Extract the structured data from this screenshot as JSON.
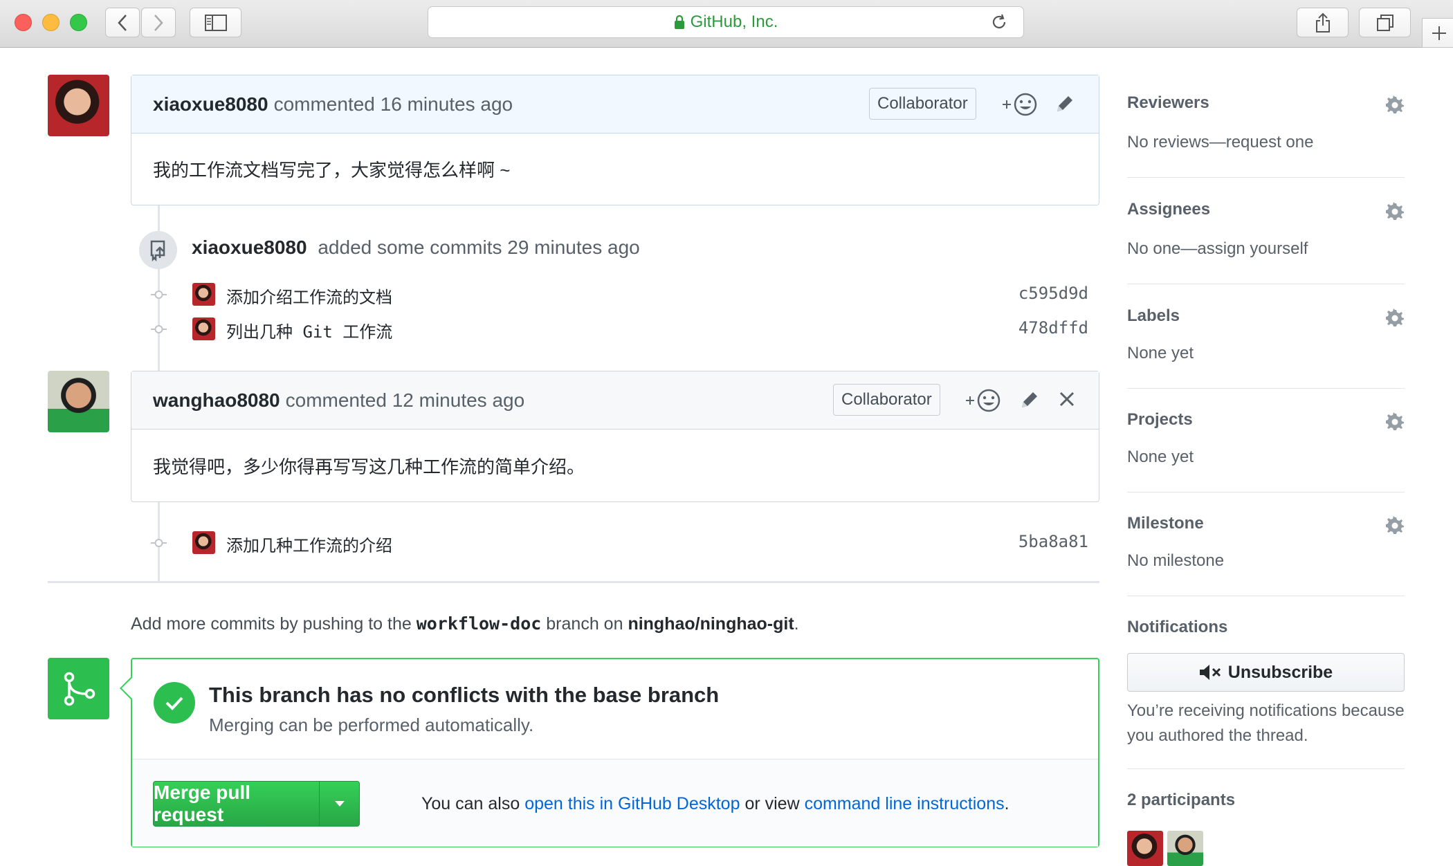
{
  "browser": {
    "url_display": "GitHub, Inc.",
    "buttons": {
      "back": "back",
      "forward": "forward",
      "sidebar": "sidebar",
      "share": "share",
      "tabs": "tabs",
      "new_tab": "new-tab"
    }
  },
  "timeline": {
    "comments": [
      {
        "author": "xiaoxue8080",
        "action": "commented 16 minutes ago",
        "badge": "Collaborator",
        "body": "我的工作流文档写完了，大家觉得怎么样啊 ~"
      },
      {
        "author": "wanghao8080",
        "action": "commented 12 minutes ago",
        "badge": "Collaborator",
        "body": "我觉得吧，多少你得再写写这几种工作流的简单介绍。"
      }
    ],
    "commit_event": {
      "author": "xiaoxue8080",
      "action": "added some commits 29 minutes ago"
    },
    "commits": [
      {
        "message": "添加介绍工作流的文档",
        "sha": "c595d9d"
      },
      {
        "message": "列出几种 Git 工作流",
        "sha": "478dffd"
      },
      {
        "message": "添加几种工作流的介绍",
        "sha": "5ba8a81"
      }
    ],
    "push_hint": {
      "prefix": "Add more commits by pushing to the",
      "branch": "workflow-doc",
      "middle": "branch on",
      "repo": "ninghao/ninghao-git",
      "suffix": "."
    }
  },
  "merge": {
    "title": "This branch has no conflicts with the base branch",
    "subtitle": "Merging can be performed automatically.",
    "button_label": "Merge pull request",
    "alt_prefix": "You can also",
    "alt_link1": "open this in GitHub Desktop",
    "alt_middle": "or view",
    "alt_link2": "command line instructions",
    "alt_suffix": "."
  },
  "sidebar": {
    "reviewers": {
      "title": "Reviewers",
      "value": "No reviews—request one"
    },
    "assignees": {
      "title": "Assignees",
      "value": "No one—assign yourself"
    },
    "labels": {
      "title": "Labels",
      "value": "None yet"
    },
    "projects": {
      "title": "Projects",
      "value": "None yet"
    },
    "milestone": {
      "title": "Milestone",
      "value": "No milestone"
    },
    "notifications": {
      "title": "Notifications",
      "button": "Unsubscribe",
      "text": "You’re receiving notifications because you authored the thread."
    },
    "participants": {
      "title": "2 participants"
    }
  },
  "colors": {
    "accent_green": "#2cbe4e",
    "link_blue": "#0366d6",
    "own_comment_header": "#f1f8ff"
  }
}
